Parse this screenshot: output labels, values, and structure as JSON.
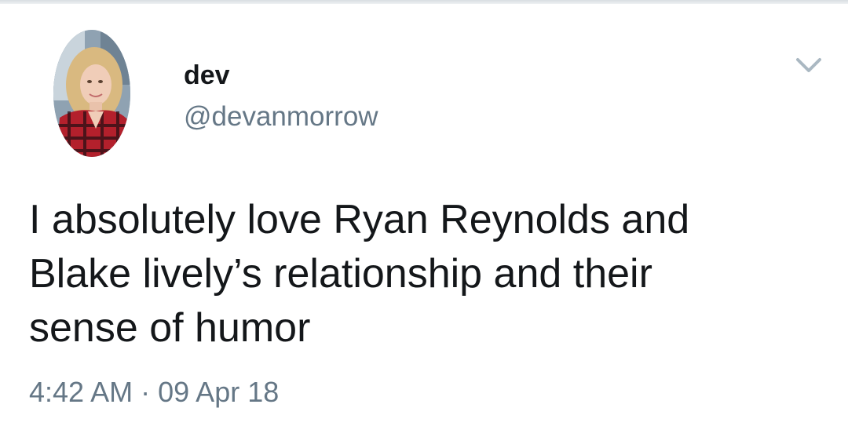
{
  "author": {
    "display_name": "dev",
    "handle": "@devanmorrow",
    "avatar_icon": "profile-photo"
  },
  "tweet": {
    "lines": [
      "I absolutely love Ryan Reynolds and",
      "Blake lively’s relationship and their",
      "sense of humor"
    ],
    "time": "4:42 AM",
    "separator": "·",
    "date": "09 Apr 18"
  },
  "actions": {
    "menu_icon": "chevron-down-icon"
  },
  "colors": {
    "text_primary": "#14171a",
    "text_secondary": "#657786",
    "chevron": "#aab8c2"
  }
}
